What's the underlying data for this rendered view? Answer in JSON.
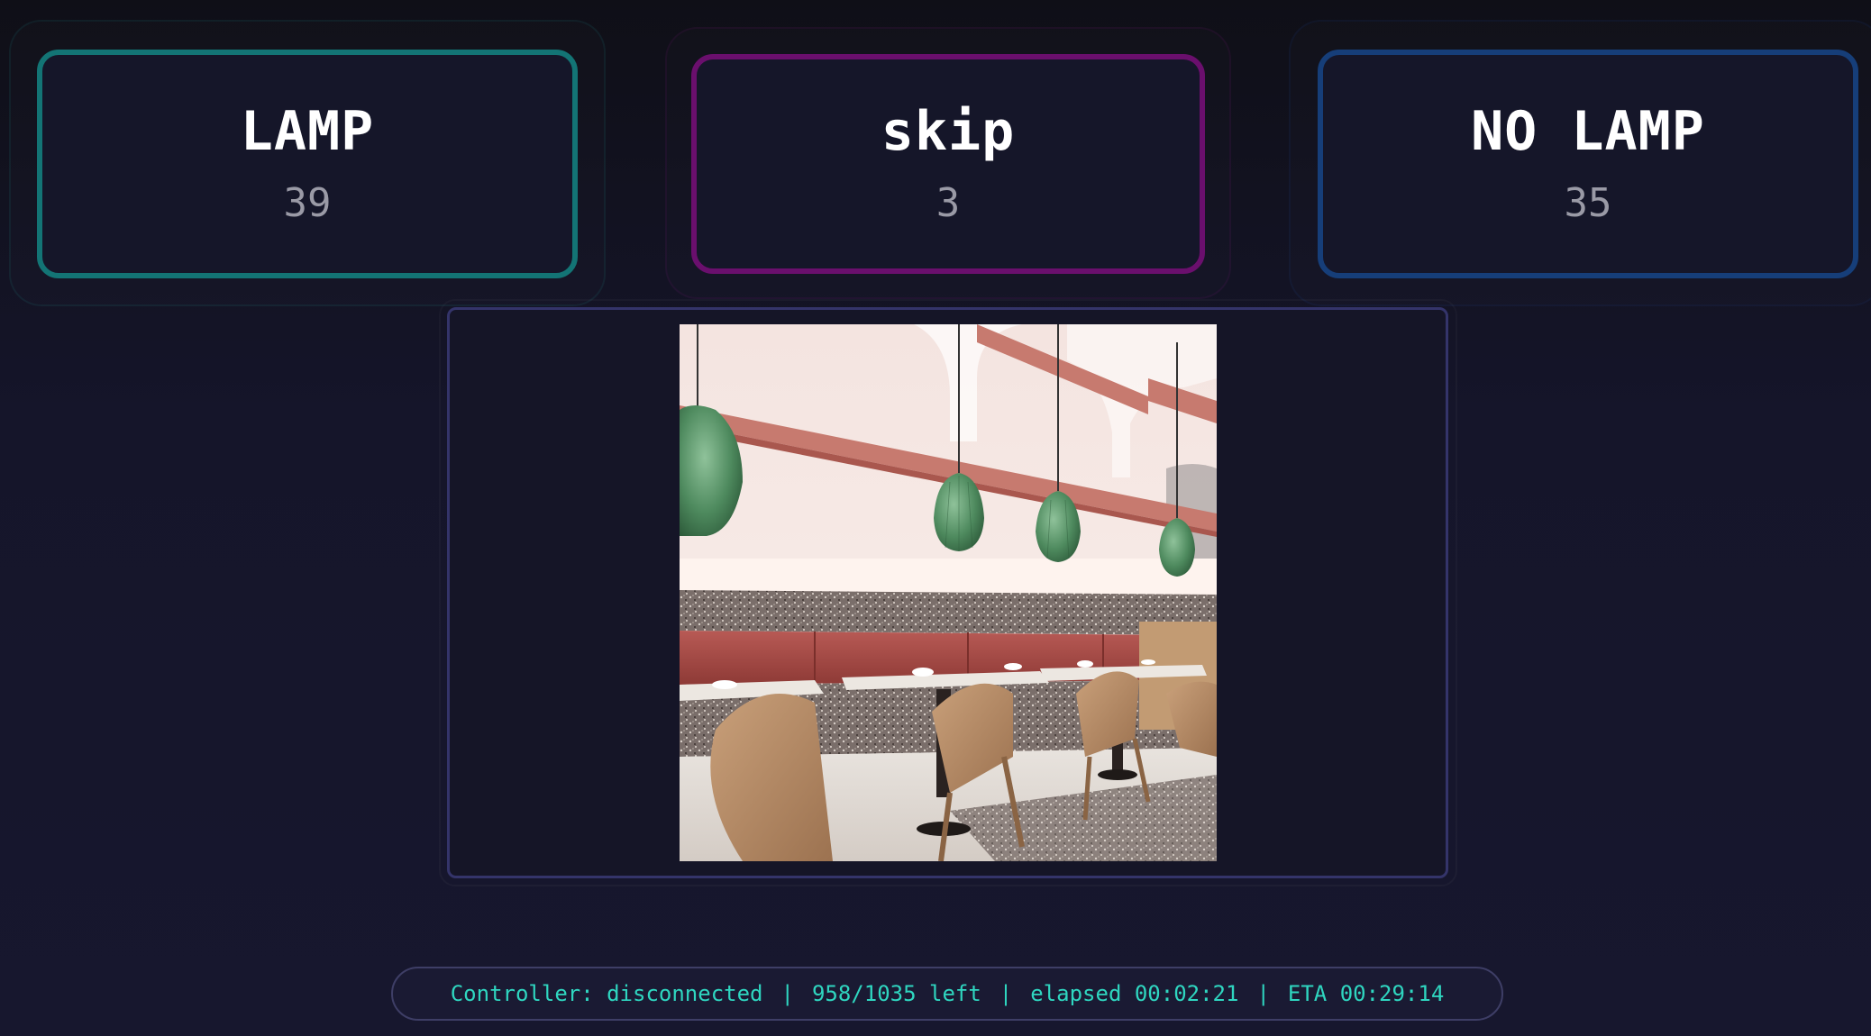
{
  "choices": [
    {
      "id": "lamp",
      "label": "LAMP",
      "count": "39",
      "accent": "#137475"
    },
    {
      "id": "skip",
      "label": "skip",
      "count": "3",
      "accent": "#6a0f6d"
    },
    {
      "id": "nolamp",
      "label": "NO LAMP",
      "count": "35",
      "accent": "#163e79"
    }
  ],
  "image": {
    "alt": "restaurant interior"
  },
  "status": {
    "controller": "Controller: disconnected",
    "remaining": "958/1035 left",
    "elapsed": "elapsed 00:02:21",
    "eta": "ETA 00:29:14",
    "separator": "|"
  },
  "colors": {
    "status_text": "#2fd6c0",
    "background": "#15152a"
  }
}
